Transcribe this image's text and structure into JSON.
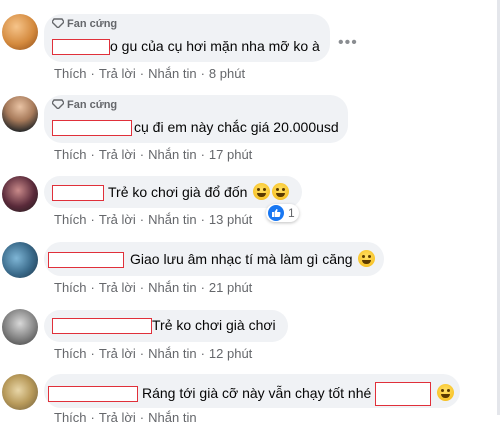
{
  "badge_label": "Fan cứng",
  "action_labels": {
    "like": "Thích",
    "reply": "Trả lời",
    "message": "Nhắn tin"
  },
  "comments": [
    {
      "text": "o gu của cụ hơi mặn nha mỡ ko à",
      "time": "8 phút"
    },
    {
      "text": "cụ đi em này chắc giá 20.000usd",
      "time": "17 phút"
    },
    {
      "text": "Trẻ ko chơi già đổ đốn",
      "time": "13 phút",
      "reaction_count": "1"
    },
    {
      "text": "Giao lưu âm nhạc tí mà làm gì căng",
      "time": "21 phút"
    },
    {
      "text": "Trẻ ko chơi già chơi",
      "time": "12 phút"
    },
    {
      "text": "Ráng tới già cỡ này vẫn chạy tốt nhé",
      "time": ""
    }
  ],
  "icons": {
    "more": "more-options-icon",
    "fan_badge": "diamond-icon",
    "emoji": "laughing-emoji-icon",
    "like": "like-thumb-icon"
  },
  "colors": {
    "bubble": "#f0f2f5",
    "meta_text": "#65676b",
    "like_blue": "#1877f2",
    "redaction": "#e0303a"
  }
}
